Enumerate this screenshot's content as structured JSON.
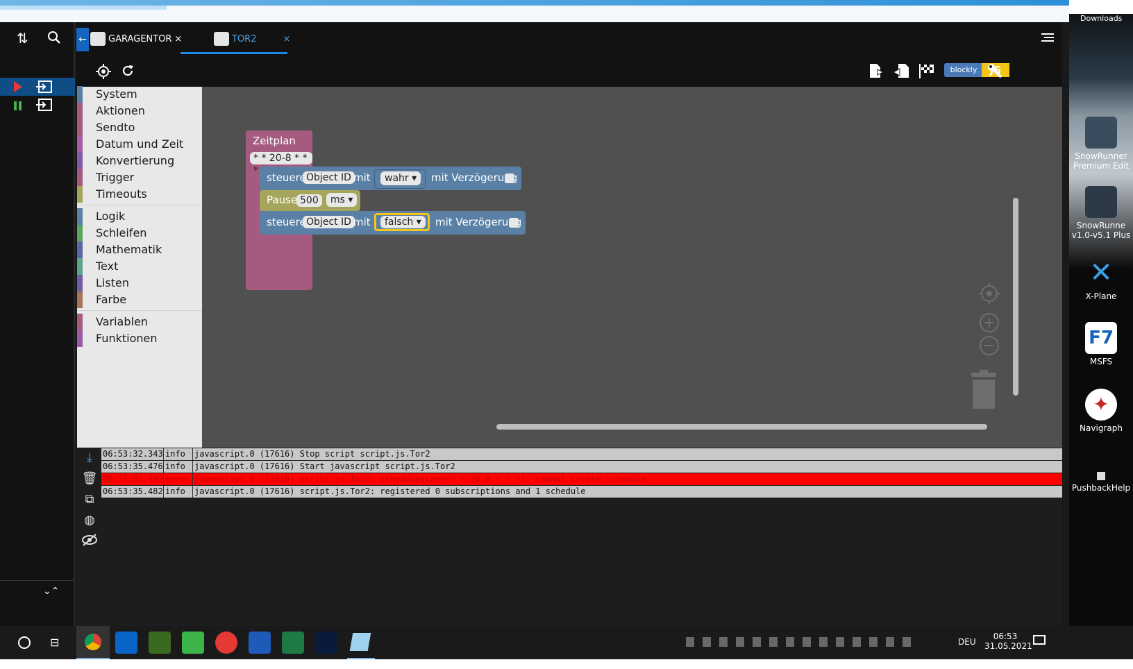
{
  "tabs": [
    {
      "label": "GARAGENTOR",
      "close": "×"
    },
    {
      "label": "TOR2",
      "close": "×"
    }
  ],
  "toolbar": {
    "blockly_label": "blockly",
    "js_label": "JS"
  },
  "toolbox": {
    "items": [
      {
        "label": "System",
        "color": "#5b80a5"
      },
      {
        "label": "Aktionen",
        "color": "#a55b80"
      },
      {
        "label": "Sendto",
        "color": "#a55b80"
      },
      {
        "label": "Datum und Zeit",
        "color": "#a55ba5"
      },
      {
        "label": "Konvertierung",
        "color": "#805ba5"
      },
      {
        "label": "Trigger",
        "color": "#a55b80"
      },
      {
        "label": "Timeouts",
        "color": "#a5a55b"
      },
      {
        "label": "Logik",
        "color": "#5b80a5"
      },
      {
        "label": "Schleifen",
        "color": "#5ba55b"
      },
      {
        "label": "Mathematik",
        "color": "#5b67a5"
      },
      {
        "label": "Text",
        "color": "#5ba58c"
      },
      {
        "label": "Listen",
        "color": "#745ba5"
      },
      {
        "label": "Farbe",
        "color": "#a5745b"
      },
      {
        "label": "Variablen",
        "color": "#a55b80"
      },
      {
        "label": "Funktionen",
        "color": "#995ba5"
      }
    ]
  },
  "blocks": {
    "schedule_title": "Zeitplan",
    "cron": "* * 20-8 * * *",
    "control1": {
      "prefix": "steuere",
      "object": "Object ID",
      "mit": "mit",
      "value": "wahr",
      "delay": "mit Verzögerung"
    },
    "pause": {
      "label": "Pause",
      "value": "500",
      "unit": "ms"
    },
    "control2": {
      "prefix": "steuere",
      "object": "Object ID",
      "mit": "mit",
      "value": "falsch",
      "delay": "mit Verzögerung"
    }
  },
  "log": [
    {
      "time": "06:53:32.343",
      "level": "info",
      "msg": "javascript.0 (17616) Stop script script.js.Tor2"
    },
    {
      "time": "06:53:35.476",
      "level": "info",
      "msg": "javascript.0 (17616) Start javascript script.js.Tor2"
    },
    {
      "time": "06:53:35.482",
      "level": "error",
      "msg": "javascript.0 (17616) script.js.Tor2: schedule(cron=* * 20-8 * * *): cannot create schedule"
    },
    {
      "time": "06:53:35.482",
      "level": "info",
      "msg": "javascript.0 (17616) script.js.Tor2: registered 0 subscriptions and 1 schedule"
    }
  ],
  "desktop": {
    "top_label": "Downloads",
    "icons": [
      {
        "label": "SnowRunner Premium Edit"
      },
      {
        "label": "SnowRunne v1.0-v5.1 Plus"
      },
      {
        "label": "X-Plane"
      },
      {
        "label": "MSFS"
      },
      {
        "label": "Navigraph"
      },
      {
        "label": "PushbackHelp"
      }
    ]
  },
  "taskbar": {
    "lang": "DEU",
    "time": "06:53",
    "date": "31.05.2021"
  }
}
